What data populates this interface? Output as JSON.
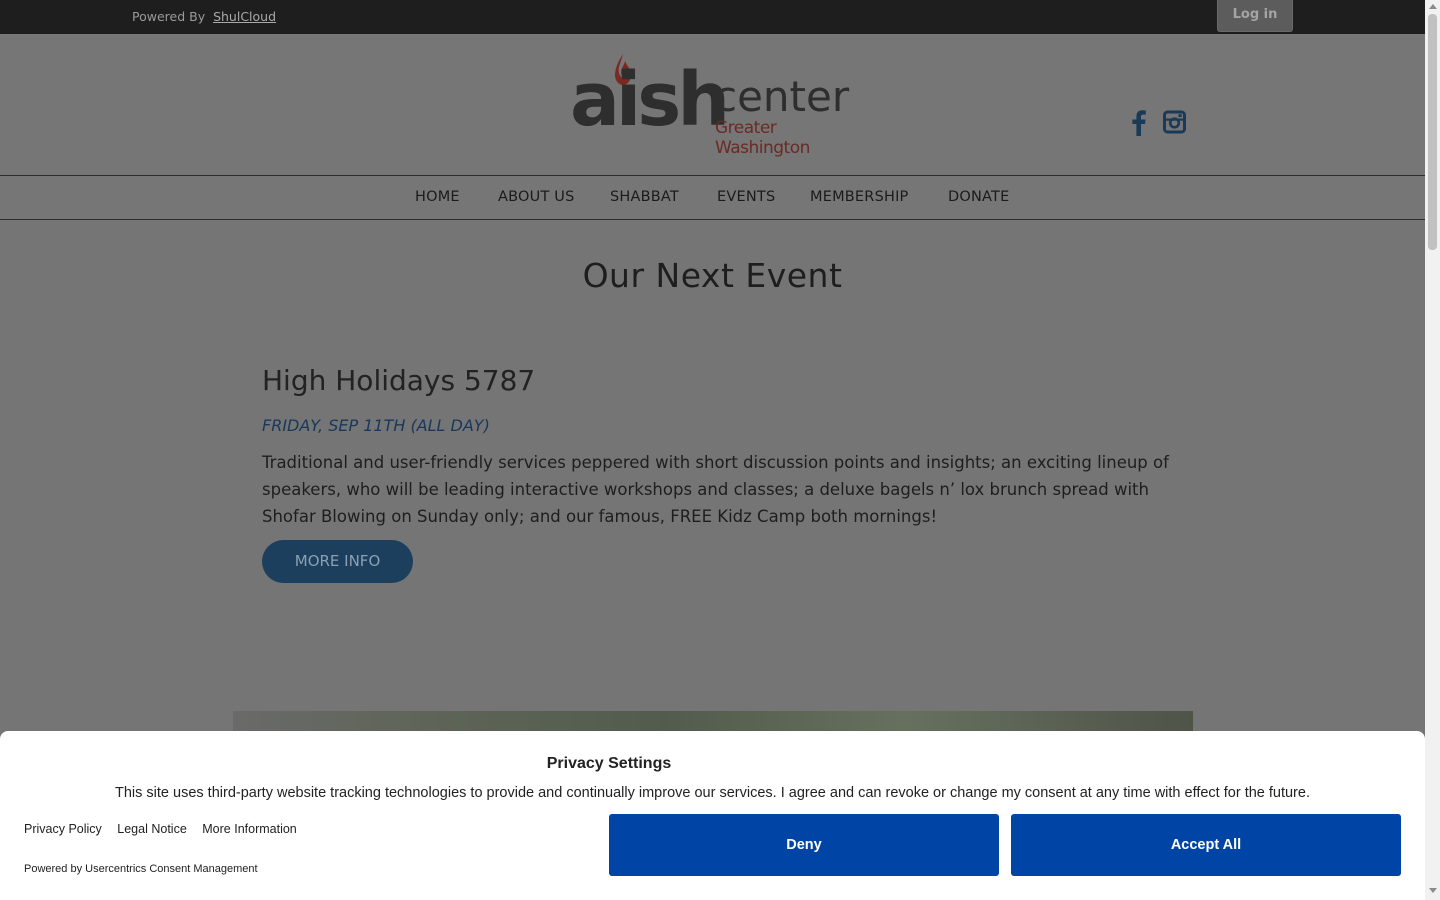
{
  "topbar": {
    "powered_by": "Powered By",
    "powered_link": "ShulCloud",
    "login": "Log in"
  },
  "logo": {
    "main": "aish",
    "center": "center",
    "subtitle": "Greater Washington",
    "flame_color": "#7a2a22"
  },
  "social": [
    "facebook-icon",
    "instagram-icon"
  ],
  "nav": [
    "HOME",
    "ABOUT US",
    "SHABBAT",
    "EVENTS",
    "MEMBERSHIP",
    "DONATE"
  ],
  "main": {
    "section_title": "Our Next Event",
    "event_title": "High Holidays 5787",
    "event_date": "FRIDAY, SEP 11TH (ALL DAY)",
    "event_description": "Traditional and user-friendly services peppered with short discussion points and insights; an exciting lineup of speakers, who will be leading interactive workshops and classes; a deluxe bagels n’ lox brunch spread with Shofar Blowing on Sunday only; and our famous, FREE Kidz Camp both mornings!",
    "more_info": "MORE INFO"
  },
  "consent": {
    "title": "Privacy Settings",
    "text": "This site uses third-party website tracking technologies to provide and continually improve our services. I agree and can revoke or change my consent at any time with effect for the future.",
    "links": [
      "Privacy Policy",
      "Legal Notice",
      "More Information"
    ],
    "powered": "Powered by Usercentrics Consent Management",
    "deny": "Deny",
    "accept": "Accept All",
    "button_color": "#0045a5"
  }
}
